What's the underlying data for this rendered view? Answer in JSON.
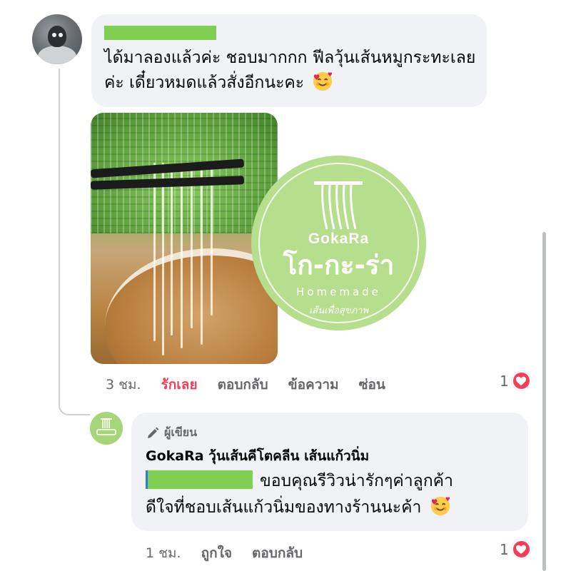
{
  "comment": {
    "text": "ได้มาลองแล้วค่ะ ชอบมากกก ฟีลวุ้นเส้นหมูกระทะเลยค่ะ เดี๋ยวหมดแล้วสั่งอีกนะคะ",
    "emoji": "smiling-face-with-hearts",
    "time": "3 ชม.",
    "actions": {
      "like": "รักเลย",
      "reply": "ตอบกลับ",
      "message": "ข้อความ",
      "hide": "ซ่อน"
    },
    "reaction_count": "1",
    "reaction_type": "love"
  },
  "watermark": {
    "brand": "GokaRa",
    "thai_name": "โก-กะ-ร่า",
    "subtitle": "Homemade",
    "tagline": "เส้นเพื่อสุขภาพ"
  },
  "reply": {
    "badge": "ผู้เขียน",
    "page_name": "GokaRa วุ้นเส้นคีโตคลีน เส้นแก้วนิ่ม",
    "text_line1": "ขอบคุณรีวิวน่ารักๆค่าลูกค้า",
    "text_line2": "ดีใจที่ชอบเส้นแก้วนิ่มของทางร้านนะค้า",
    "emoji": "smiling-face-with-hearts",
    "time": "1 ชม.",
    "actions": {
      "like": "ถูกใจ",
      "reply": "ตอบกลับ"
    },
    "reaction_count": "1",
    "reaction_type": "love"
  },
  "colors": {
    "bubble": "#f0f2f5",
    "love": "#f33e58",
    "redaction": "#7fcf52",
    "logo": "#b5de8d"
  }
}
